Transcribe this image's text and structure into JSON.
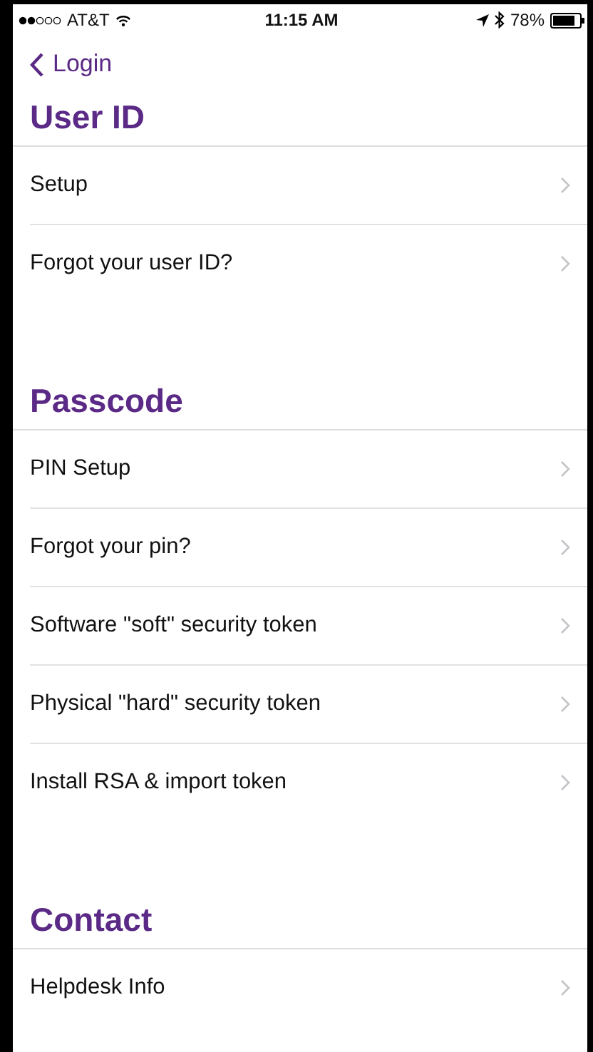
{
  "status_bar": {
    "carrier": "AT&T",
    "time": "11:15 AM",
    "battery": "78%"
  },
  "nav": {
    "back": "Login"
  },
  "sections": [
    {
      "title": "User ID",
      "items": [
        "Setup",
        "Forgot your user ID?"
      ]
    },
    {
      "title": "Passcode",
      "items": [
        "PIN Setup",
        "Forgot your pin?",
        "Software \"soft\" security token",
        "Physical \"hard\" security token",
        "Install RSA & import token"
      ]
    },
    {
      "title": "Contact",
      "items": [
        "Helpdesk Info"
      ]
    }
  ]
}
